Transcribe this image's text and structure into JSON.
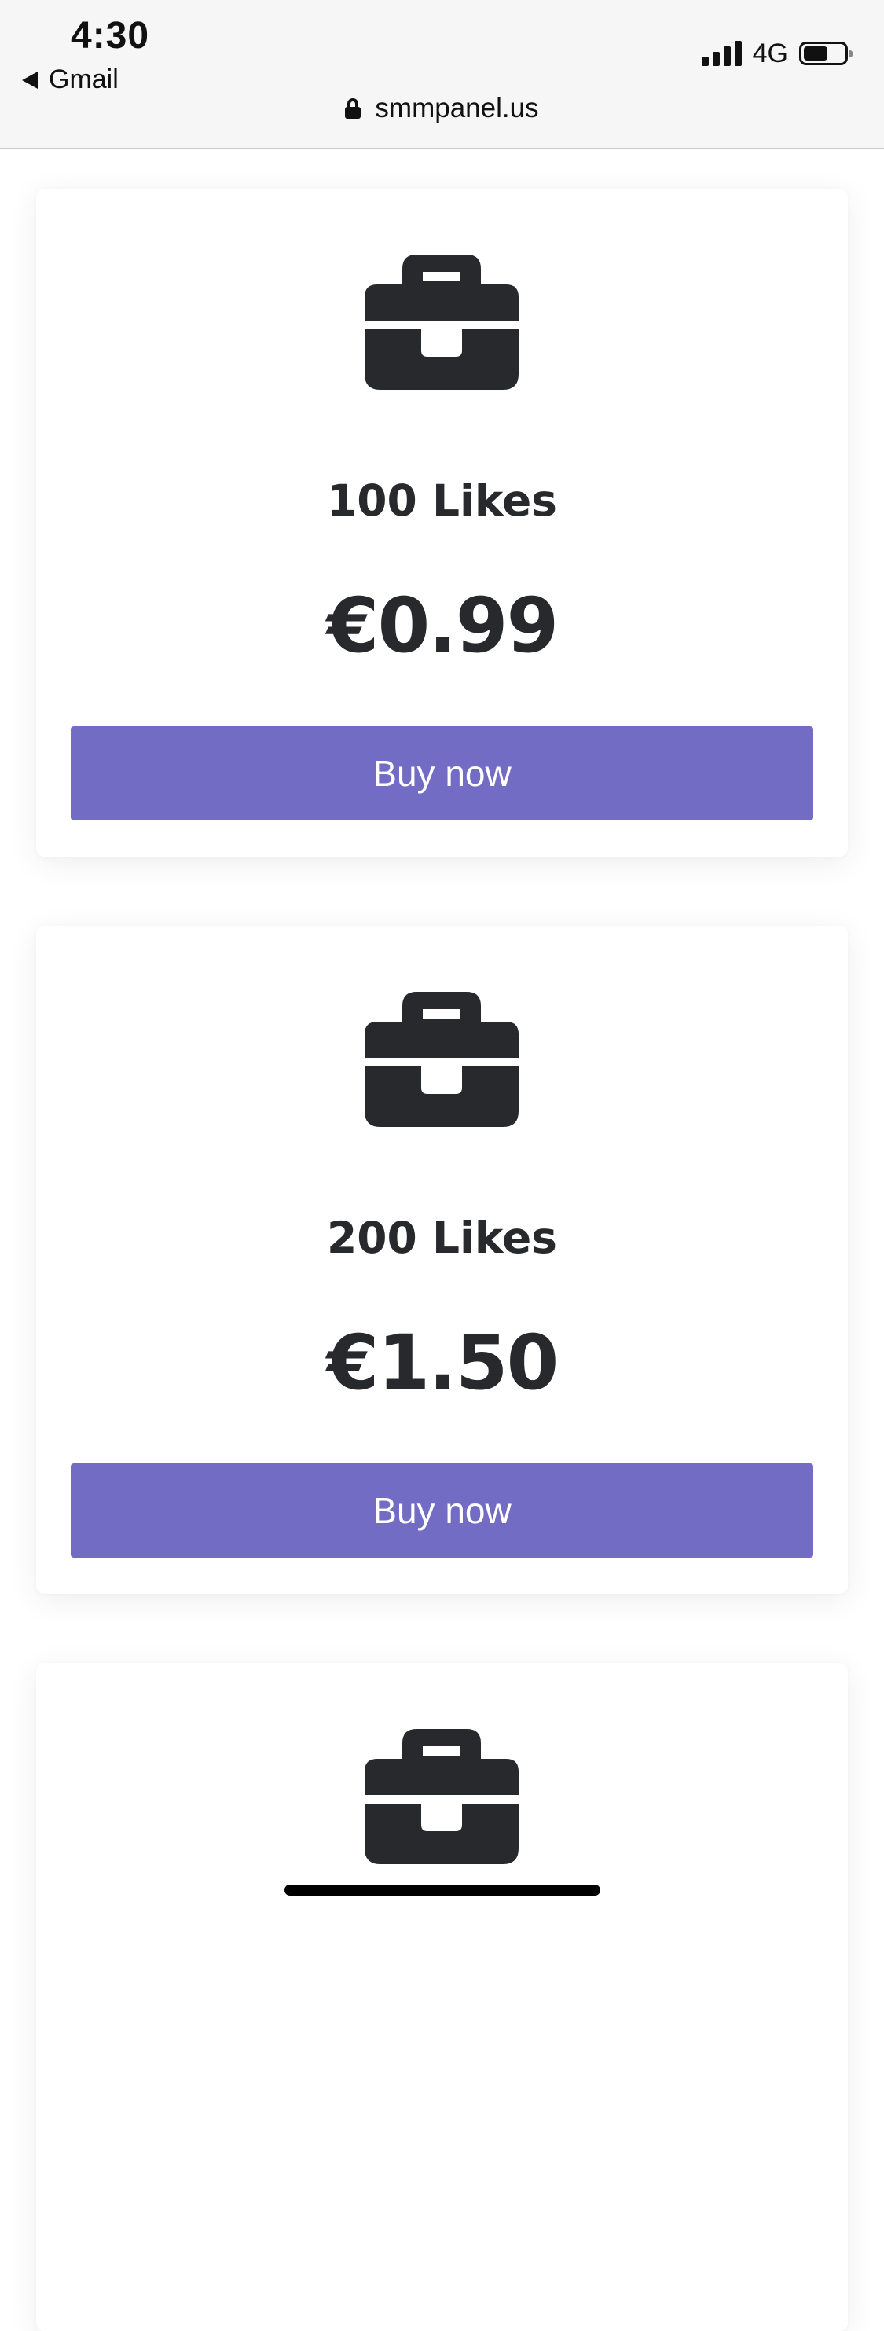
{
  "status_bar": {
    "time": "4:30",
    "back_app": "Gmail",
    "network": "4G",
    "battery_level": 0.6
  },
  "browser": {
    "url": "smmpanel.us"
  },
  "cards": [
    {
      "title": "100 Likes",
      "price": "€0.99",
      "button_label": "Buy now",
      "icon": "briefcase-icon"
    },
    {
      "title": "200 Likes",
      "price": "€1.50",
      "button_label": "Buy now",
      "icon": "briefcase-icon"
    },
    {
      "icon": "briefcase-icon"
    }
  ],
  "colors": {
    "accent": "#736cc4",
    "text": "#28292c"
  }
}
